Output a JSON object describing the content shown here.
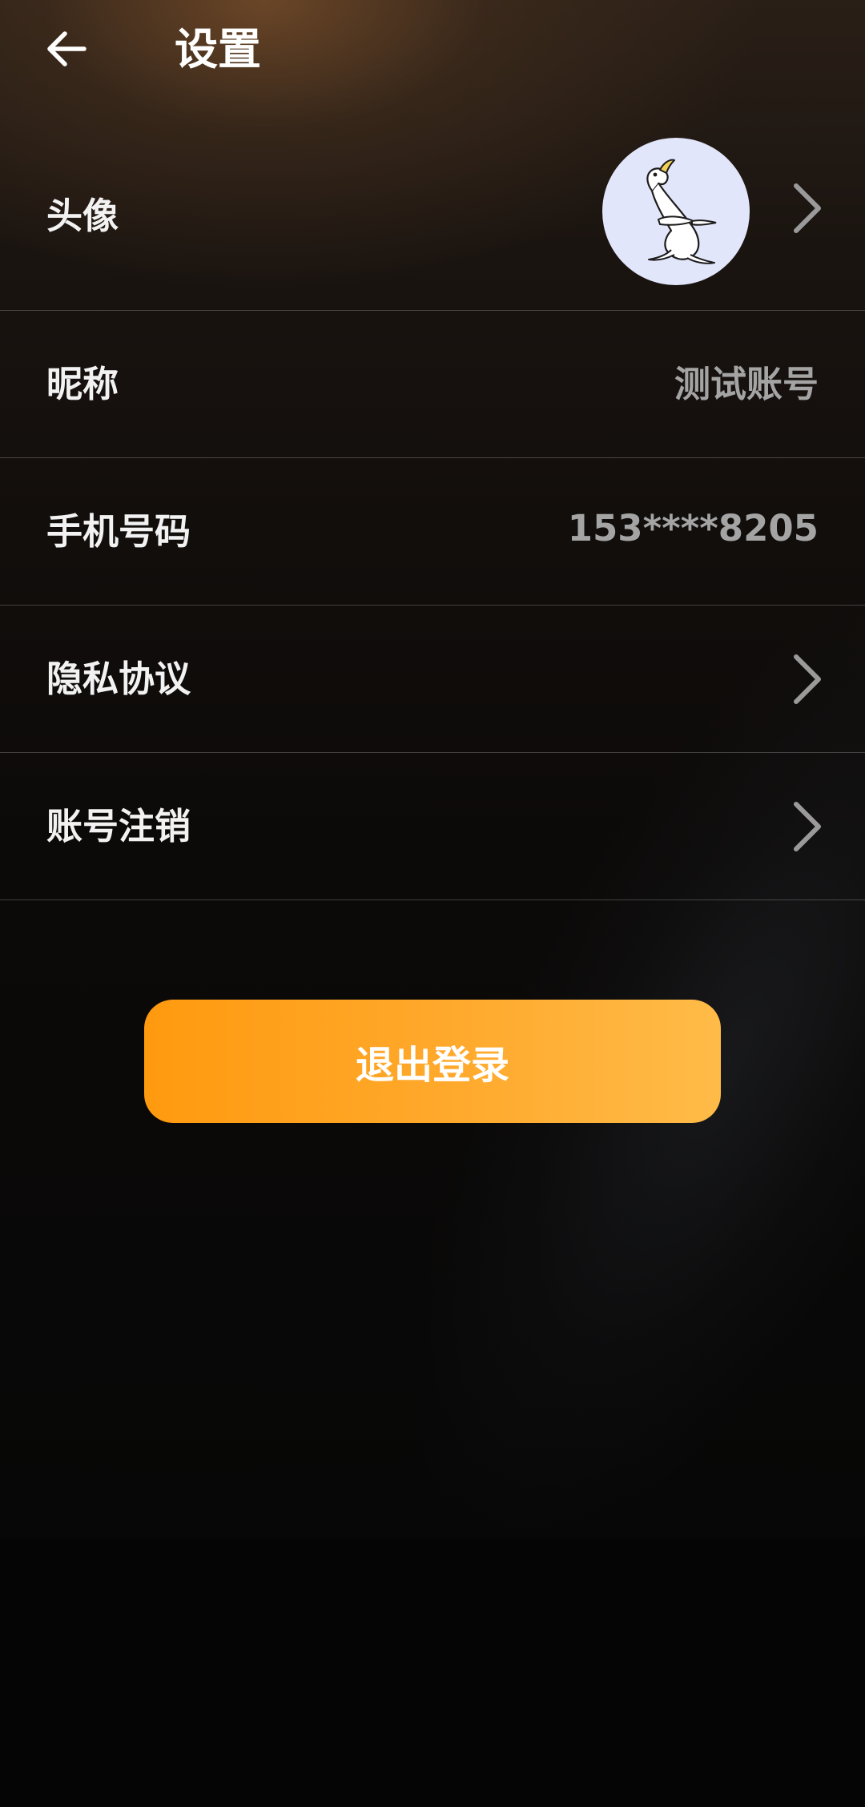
{
  "header": {
    "title": "设置",
    "back_icon": "arrow-left-icon"
  },
  "settings": {
    "avatar": {
      "label": "头像",
      "icon": "chevron-right-icon"
    },
    "nickname": {
      "label": "昵称",
      "value": "测试账号"
    },
    "phone": {
      "label": "手机号码",
      "value": "153****8205"
    },
    "privacy": {
      "label": "隐私协议",
      "icon": "chevron-right-icon"
    },
    "deactivate": {
      "label": "账号注销",
      "icon": "chevron-right-icon"
    }
  },
  "logout": {
    "label": "退出登录"
  },
  "colors": {
    "accent_start": "#ff9a0f",
    "accent_end": "#ffbb48",
    "value_text": "#a4a4a4",
    "avatar_bg": "#e2e6fb"
  }
}
